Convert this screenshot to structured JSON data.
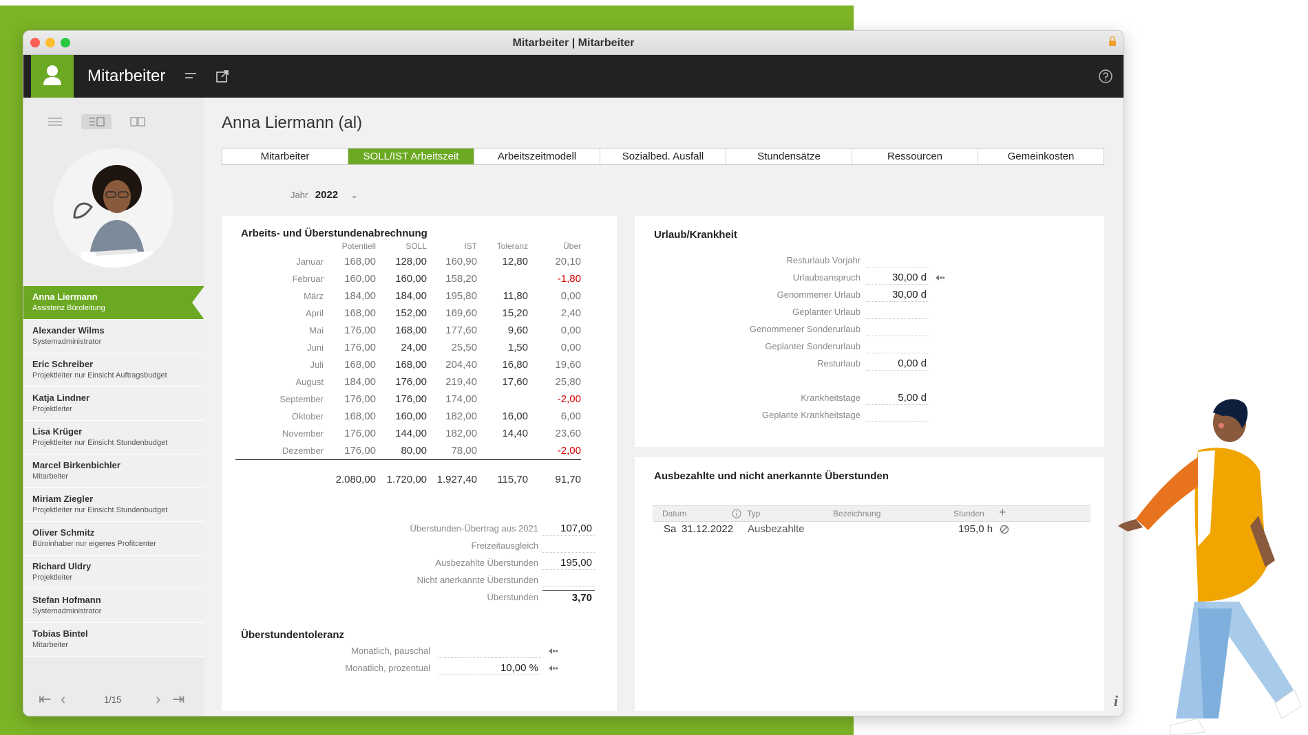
{
  "window": {
    "title": "Mitarbeiter | Mitarbeiter"
  },
  "header": {
    "title": "Mitarbeiter"
  },
  "sidebar": {
    "employees": [
      {
        "name": "Anna Liermann",
        "role": "Assistenz Büroleitung"
      },
      {
        "name": "Alexander Wilms",
        "role": "Systemadministrator"
      },
      {
        "name": "Eric Schreiber",
        "role": "Projektleiter nur Einsicht Auftragsbudget"
      },
      {
        "name": "Katja Lindner",
        "role": "Projektleiter"
      },
      {
        "name": "Lisa Krüger",
        "role": "Projektleiter nur Einsicht Stundenbudget"
      },
      {
        "name": "Marcel Birkenbichler",
        "role": "Mitarbeiter"
      },
      {
        "name": "Miriam Ziegler",
        "role": "Projektleiter nur Einsicht Stundenbudget"
      },
      {
        "name": "Oliver Schmitz",
        "role": "Büroinhaber nur eigenes Profitcenter"
      },
      {
        "name": "Richard Uldry",
        "role": "Projektleiter"
      },
      {
        "name": "Stefan Hofmann",
        "role": "Systemadministrator"
      },
      {
        "name": "Tobias Bintel",
        "role": "Mitarbeiter"
      }
    ],
    "pager": {
      "text": "1/15"
    }
  },
  "main": {
    "title": "Anna Liermann (al)",
    "tabs": [
      "Mitarbeiter",
      "SOLL/IST Arbeitszeit",
      "Arbeitszeitmodell",
      "Sozialbed. Ausfall",
      "Stundensätze",
      "Ressourcen",
      "Gemeinkosten"
    ],
    "year": {
      "label": "Jahr",
      "value": "2022"
    }
  },
  "overtime": {
    "title": "Arbeits- und Überstundenabrechnung",
    "columns": [
      "Potentiell",
      "SOLL",
      "IST",
      "Toleranz",
      "Über"
    ],
    "rows": [
      {
        "month": "Januar",
        "pot": "168,00",
        "soll": "128,00",
        "ist": "160,90",
        "tol": "12,80",
        "ueber": "20,10"
      },
      {
        "month": "Februar",
        "pot": "160,00",
        "soll": "160,00",
        "ist": "158,20",
        "tol": "",
        "ueber": "-1,80"
      },
      {
        "month": "März",
        "pot": "184,00",
        "soll": "184,00",
        "ist": "195,80",
        "tol": "11,80",
        "ueber": "0,00"
      },
      {
        "month": "April",
        "pot": "168,00",
        "soll": "152,00",
        "ist": "169,60",
        "tol": "15,20",
        "ueber": "2,40"
      },
      {
        "month": "Mai",
        "pot": "176,00",
        "soll": "168,00",
        "ist": "177,60",
        "tol": "9,60",
        "ueber": "0,00"
      },
      {
        "month": "Juni",
        "pot": "176,00",
        "soll": "24,00",
        "ist": "25,50",
        "tol": "1,50",
        "ueber": "0,00"
      },
      {
        "month": "Juli",
        "pot": "168,00",
        "soll": "168,00",
        "ist": "204,40",
        "tol": "16,80",
        "ueber": "19,60"
      },
      {
        "month": "August",
        "pot": "184,00",
        "soll": "176,00",
        "ist": "219,40",
        "tol": "17,60",
        "ueber": "25,80"
      },
      {
        "month": "September",
        "pot": "176,00",
        "soll": "176,00",
        "ist": "174,00",
        "tol": "",
        "ueber": "-2,00"
      },
      {
        "month": "Oktober",
        "pot": "168,00",
        "soll": "160,00",
        "ist": "182,00",
        "tol": "16,00",
        "ueber": "6,00"
      },
      {
        "month": "November",
        "pot": "176,00",
        "soll": "144,00",
        "ist": "182,00",
        "tol": "14,40",
        "ueber": "23,60"
      },
      {
        "month": "Dezember",
        "pot": "176,00",
        "soll": "80,00",
        "ist": "78,00",
        "tol": "",
        "ueber": "-2,00"
      }
    ],
    "totals": {
      "pot": "2.080,00",
      "soll": "1.720,00",
      "ist": "1.927,40",
      "tol": "115,70",
      "ueber": "91,70"
    },
    "summary": [
      {
        "label": "Überstunden-Übertrag aus 2021",
        "value": "107,00"
      },
      {
        "label": "Freizeitausgleich",
        "value": ""
      },
      {
        "label": "Ausbezahlte Überstunden",
        "value": "195,00"
      },
      {
        "label": "Nicht anerkannte Überstunden",
        "value": ""
      },
      {
        "label": "Überstunden",
        "value": "3,70"
      }
    ],
    "tolerance": {
      "title": "Überstundentoleranz",
      "monthly_flat_label": "Monatlich, pauschal",
      "monthly_flat_value": "",
      "monthly_pct_label": "Monatlich, prozentual",
      "monthly_pct_value": "10,00 %"
    }
  },
  "vacation": {
    "title": "Urlaub/Krankheit",
    "rows": [
      {
        "label": "Resturlaub Vorjahr",
        "value": ""
      },
      {
        "label": "Urlaubsanspruch",
        "value": "30,00 d"
      },
      {
        "label": "Genommener Urlaub",
        "value": "30,00 d"
      },
      {
        "label": "Geplanter Urlaub",
        "value": ""
      },
      {
        "label": "Genommener Sonderurlaub",
        "value": ""
      },
      {
        "label": "Geplanter Sonderurlaub",
        "value": ""
      },
      {
        "label": "Resturlaub",
        "value": "0,00 d"
      }
    ],
    "sick": [
      {
        "label": "Krankheitstage",
        "value": "5,00 d"
      },
      {
        "label": "Geplante Krankheitstage",
        "value": ""
      }
    ]
  },
  "payout": {
    "title": "Ausbezahlte und nicht anerkannte Überstunden",
    "columns": {
      "date": "Datum",
      "type": "Typ",
      "desc": "Bezeichnung",
      "hours": "Stunden"
    },
    "rows": [
      {
        "weekday": "Sa",
        "date": "31.12.2022",
        "type": "Ausbezahlte",
        "desc": "",
        "hours": "195,0 h"
      }
    ]
  },
  "colors": {
    "accent": "#6ca922",
    "background_green": "#7cb426",
    "header": "#222222",
    "negative": "#d10000"
  }
}
